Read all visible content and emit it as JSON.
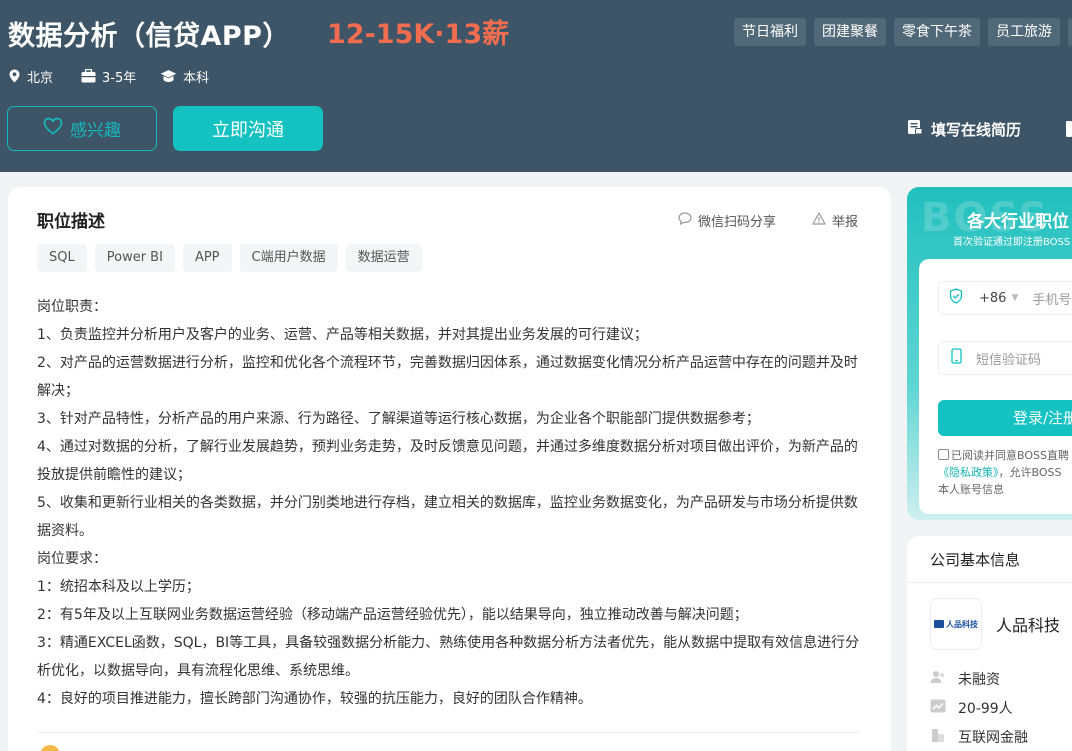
{
  "job": {
    "title": "数据分析（信贷APP）",
    "salary": "12-15K·13薪",
    "benefits": [
      "节日福利",
      "团建聚餐",
      "零食下午茶",
      "员工旅游"
    ],
    "city": "北京",
    "experience": "3-5年",
    "education": "本科"
  },
  "actions": {
    "interest": "感兴趣",
    "chat": "立即沟通",
    "resume": "填写在线简历"
  },
  "description": {
    "heading": "职位描述",
    "share": "微信扫码分享",
    "report": "举报",
    "tags": [
      "SQL",
      "Power BI",
      "APP",
      "C端用户数据",
      "数据运营"
    ],
    "lines": [
      "岗位职责：",
      "1、负责监控并分析用户及客户的业务、运营、产品等相关数据，并对其提出业务发展的可行建议；",
      "2、对产品的运营数据进行分析，监控和优化各个流程环节，完善数据归因体系，通过数据变化情况分析产品运营中存在的问题并及时解决；",
      "3、针对产品特性，分析产品的用户来源、行为路径、了解渠道等运行核心数据，为企业各个职能部门提供数据参考；",
      "4、通过对数据的分析，了解行业发展趋势，预判业务走势，及时反馈意见问题，并通过多维度数据分析对项目做出评价，为新产品的投放提供前瞻性的建议；",
      "5、收集和更新行业相关的各类数据，并分门别类地进行存档，建立相关的数据库，监控业务数据变化，为产品研发与市场分析提供数据资料。",
      "岗位要求：",
      "1：统招本科及以上学历；",
      "2：有5年及以上互联网业务数据运营经验（移动端产品运营经验优先），能以结果导向，独立推动改善与解决问题；",
      "3：精通EXCEL函数，SQL，BI等工具，具备较强数据分析能力、熟练使用各种数据分析方法者优先，能从数据中提取有效信息进行分析优化，以数据导向，具有流程化思维、系统思维。",
      "4：良好的项目推进能力，擅长跨部门沟通协作，较强的抗压能力，良好的团队合作精神。"
    ]
  },
  "promo": {
    "bg_text": "BOSS",
    "title": "各大行业职位",
    "subtitle": "首次验证通过即注册BOSS",
    "country_code": "+86",
    "phone_placeholder": "手机号",
    "sms_placeholder": "短信验证码",
    "login_label": "登录/注册",
    "agree_text": "已阅读并同意BOSS直聘",
    "privacy_link": "《隐私政策》",
    "agree_text2": "，允许BOSS",
    "agree_text3": "本人账号信息"
  },
  "company": {
    "heading": "公司基本信息",
    "logo_text": "人品科技",
    "name": "人品科技",
    "funding": "未融资",
    "size": "20-99人",
    "industry": "互联网金融"
  }
}
